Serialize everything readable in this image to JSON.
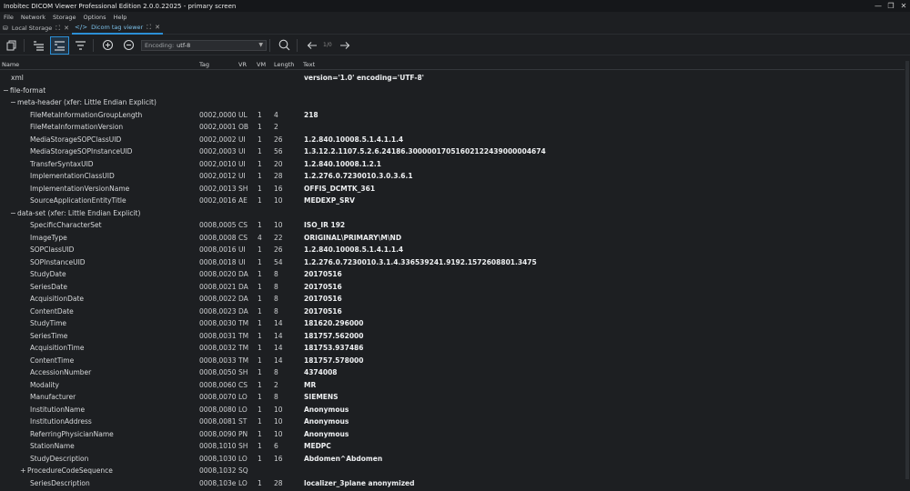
{
  "window": {
    "title": "Inobitec DICOM Viewer Professional Edition 2.0.0.22025 - primary screen",
    "minimize": "—",
    "maximize": "❐",
    "close": "✕"
  },
  "menu": [
    "File",
    "Network",
    "Storage",
    "Options",
    "Help"
  ],
  "tabs": [
    {
      "label": "Local Storage",
      "icon": "database-icon"
    },
    {
      "label": "Dicom tag viewer",
      "icon": "code-icon"
    }
  ],
  "toolbar": {
    "encoding_label": "Encoding:",
    "encoding_value": "utf-8",
    "pager": "1/0"
  },
  "columns": [
    "Name",
    "Tag",
    "VR",
    "VM",
    "Length",
    "Text"
  ],
  "rows": [
    {
      "name": "xml",
      "tag": "",
      "vr": "",
      "vm": "",
      "len": "",
      "text": "version='1.0' encoding='UTF-8'"
    },
    {
      "name": "file-format",
      "tag": "",
      "vr": "",
      "vm": "",
      "len": "",
      "text": "",
      "expander": "−"
    },
    {
      "name": "meta-header (xfer: Little Endian Explicit)",
      "tag": "",
      "vr": "",
      "vm": "",
      "len": "",
      "text": "",
      "expander": "−"
    },
    {
      "name": "FileMetaInformationGroupLength",
      "tag": "0002,0000",
      "vr": "UL",
      "vm": "1",
      "len": "4",
      "text": "218"
    },
    {
      "name": "FileMetaInformationVersion",
      "tag": "0002,0001",
      "vr": "OB",
      "vm": "1",
      "len": "2",
      "text": ""
    },
    {
      "name": "MediaStorageSOPClassUID",
      "tag": "0002,0002",
      "vr": "UI",
      "vm": "1",
      "len": "26",
      "text": "1.2.840.10008.5.1.4.1.1.4"
    },
    {
      "name": "MediaStorageSOPInstanceUID",
      "tag": "0002,0003",
      "vr": "UI",
      "vm": "1",
      "len": "56",
      "text": "1.3.12.2.1107.5.2.6.24186.30000017051602122439000004674"
    },
    {
      "name": "TransferSyntaxUID",
      "tag": "0002,0010",
      "vr": "UI",
      "vm": "1",
      "len": "20",
      "text": "1.2.840.10008.1.2.1"
    },
    {
      "name": "ImplementationClassUID",
      "tag": "0002,0012",
      "vr": "UI",
      "vm": "1",
      "len": "28",
      "text": "1.2.276.0.7230010.3.0.3.6.1"
    },
    {
      "name": "ImplementationVersionName",
      "tag": "0002,0013",
      "vr": "SH",
      "vm": "1",
      "len": "16",
      "text": "OFFIS_DCMTK_361"
    },
    {
      "name": "SourceApplicationEntityTitle",
      "tag": "0002,0016",
      "vr": "AE",
      "vm": "1",
      "len": "10",
      "text": "MEDEXP_SRV"
    },
    {
      "name": "data-set (xfer: Little Endian Explicit)",
      "tag": "",
      "vr": "",
      "vm": "",
      "len": "",
      "text": "",
      "expander": "−"
    },
    {
      "name": "SpecificCharacterSet",
      "tag": "0008,0005",
      "vr": "CS",
      "vm": "1",
      "len": "10",
      "text": "ISO_IR 192"
    },
    {
      "name": "ImageType",
      "tag": "0008,0008",
      "vr": "CS",
      "vm": "4",
      "len": "22",
      "text": "ORIGINAL\\PRIMARY\\M\\ND"
    },
    {
      "name": "SOPClassUID",
      "tag": "0008,0016",
      "vr": "UI",
      "vm": "1",
      "len": "26",
      "text": "1.2.840.10008.5.1.4.1.1.4"
    },
    {
      "name": "SOPInstanceUID",
      "tag": "0008,0018",
      "vr": "UI",
      "vm": "1",
      "len": "54",
      "text": "1.2.276.0.7230010.3.1.4.336539241.9192.1572608801.3475"
    },
    {
      "name": "StudyDate",
      "tag": "0008,0020",
      "vr": "DA",
      "vm": "1",
      "len": "8",
      "text": "20170516"
    },
    {
      "name": "SeriesDate",
      "tag": "0008,0021",
      "vr": "DA",
      "vm": "1",
      "len": "8",
      "text": "20170516"
    },
    {
      "name": "AcquisitionDate",
      "tag": "0008,0022",
      "vr": "DA",
      "vm": "1",
      "len": "8",
      "text": "20170516"
    },
    {
      "name": "ContentDate",
      "tag": "0008,0023",
      "vr": "DA",
      "vm": "1",
      "len": "8",
      "text": "20170516"
    },
    {
      "name": "StudyTime",
      "tag": "0008,0030",
      "vr": "TM",
      "vm": "1",
      "len": "14",
      "text": "181620.296000"
    },
    {
      "name": "SeriesTime",
      "tag": "0008,0031",
      "vr": "TM",
      "vm": "1",
      "len": "14",
      "text": "181757.562000"
    },
    {
      "name": "AcquisitionTime",
      "tag": "0008,0032",
      "vr": "TM",
      "vm": "1",
      "len": "14",
      "text": "181753.937486"
    },
    {
      "name": "ContentTime",
      "tag": "0008,0033",
      "vr": "TM",
      "vm": "1",
      "len": "14",
      "text": "181757.578000"
    },
    {
      "name": "AccessionNumber",
      "tag": "0008,0050",
      "vr": "SH",
      "vm": "1",
      "len": "8",
      "text": "4374008"
    },
    {
      "name": "Modality",
      "tag": "0008,0060",
      "vr": "CS",
      "vm": "1",
      "len": "2",
      "text": "MR"
    },
    {
      "name": "Manufacturer",
      "tag": "0008,0070",
      "vr": "LO",
      "vm": "1",
      "len": "8",
      "text": "SIEMENS"
    },
    {
      "name": "InstitutionName",
      "tag": "0008,0080",
      "vr": "LO",
      "vm": "1",
      "len": "10",
      "text": "Anonymous"
    },
    {
      "name": "InstitutionAddress",
      "tag": "0008,0081",
      "vr": "ST",
      "vm": "1",
      "len": "10",
      "text": "Anonymous"
    },
    {
      "name": "ReferringPhysicianName",
      "tag": "0008,0090",
      "vr": "PN",
      "vm": "1",
      "len": "10",
      "text": "Anonymous"
    },
    {
      "name": "StationName",
      "tag": "0008,1010",
      "vr": "SH",
      "vm": "1",
      "len": "6",
      "text": "MEDPC"
    },
    {
      "name": "StudyDescription",
      "tag": "0008,1030",
      "vr": "LO",
      "vm": "1",
      "len": "16",
      "text": "Abdomen^Abdomen"
    },
    {
      "name": "ProcedureCodeSequence",
      "tag": "0008,1032",
      "vr": "SQ",
      "vm": "",
      "len": "",
      "text": "",
      "expander": "+"
    },
    {
      "name": "SeriesDescription",
      "tag": "0008,103e",
      "vr": "LO",
      "vm": "1",
      "len": "28",
      "text": "localizer_3plane anonymized"
    }
  ]
}
